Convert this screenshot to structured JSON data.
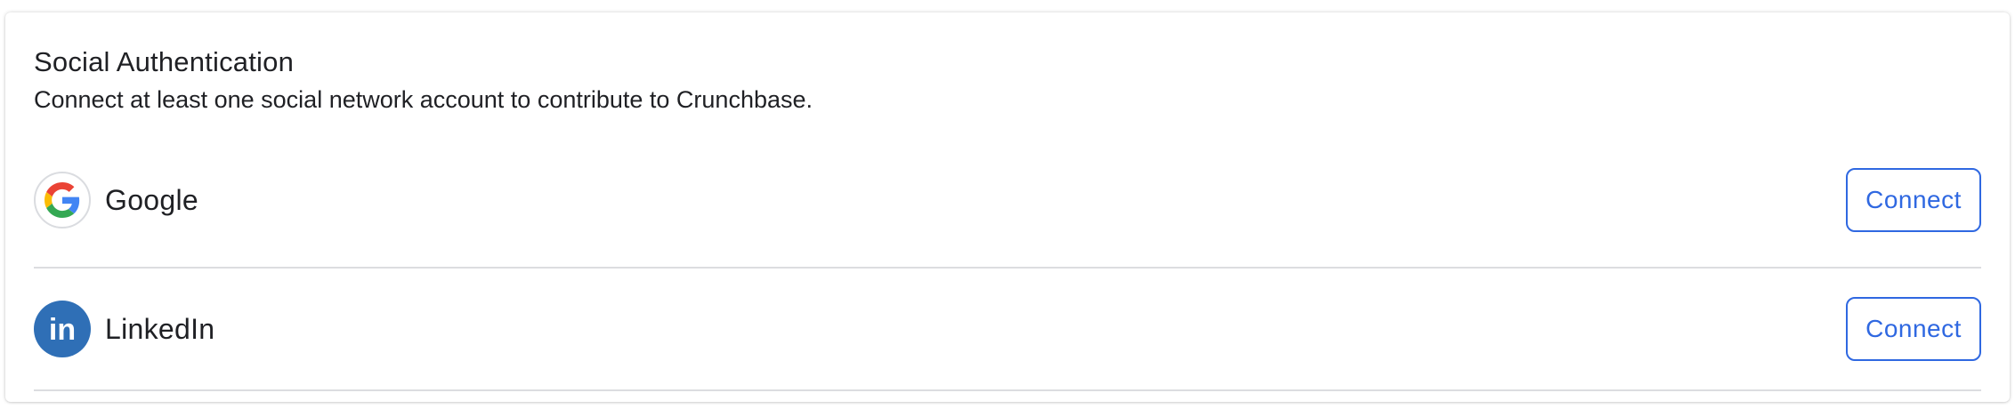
{
  "section": {
    "title": "Social Authentication",
    "subtitle": "Connect at least one social network account to contribute to Crunchbase."
  },
  "providers": [
    {
      "name": "Google",
      "icon": "google-icon",
      "button_label": "Connect"
    },
    {
      "name": "LinkedIn",
      "icon": "linkedin-icon",
      "button_label": "Connect",
      "icon_text": "in"
    }
  ],
  "colors": {
    "accent": "#2f68e1",
    "linkedin": "#2f6fb6",
    "divider": "#dcdde0",
    "text": "#1f2024"
  }
}
